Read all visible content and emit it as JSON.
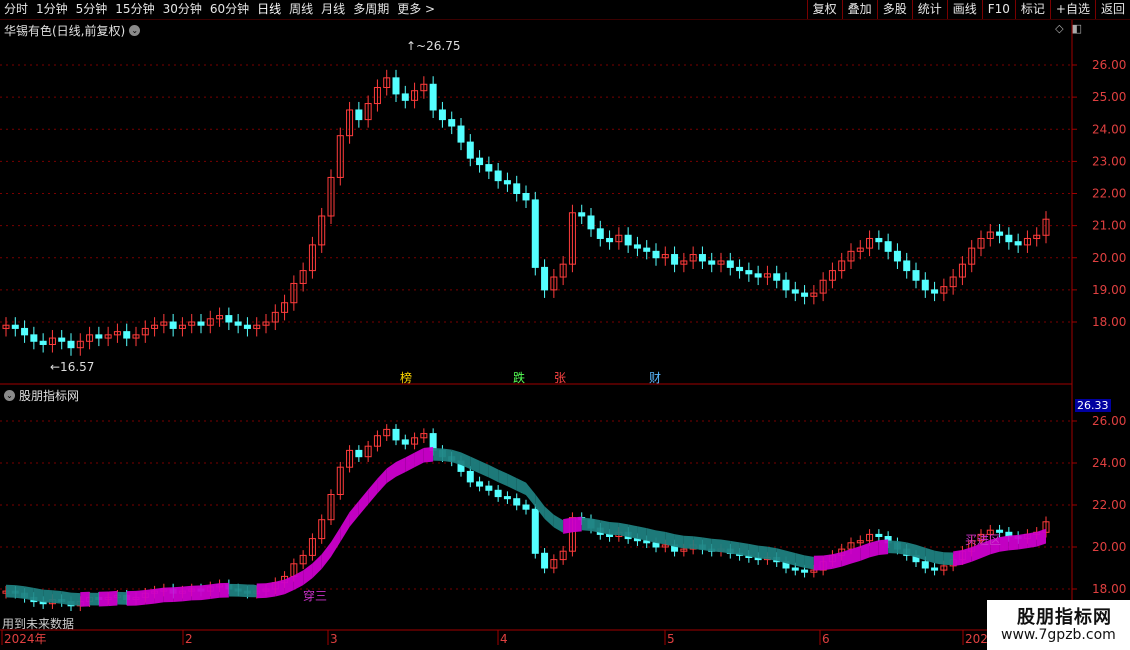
{
  "toolbar": {
    "periods": [
      "分时",
      "1分钟",
      "5分钟",
      "15分钟",
      "30分钟",
      "60分钟",
      "日线",
      "周线",
      "月线",
      "多周期",
      "更多"
    ],
    "active_period": "日线",
    "more_arrow": ">",
    "right_buttons": [
      "复权",
      "叠加",
      "多股",
      "统计",
      "画线",
      "F10",
      "标记",
      "+自选",
      "返回"
    ]
  },
  "main_panel": {
    "title": "华锡有色(日线,前复权)",
    "high_label": "26.75",
    "low_label": "16.57",
    "price_ticks": [
      "26.00",
      "25.00",
      "24.00",
      "23.00",
      "22.00",
      "21.00",
      "20.00",
      "19.00",
      "18.00"
    ],
    "event_markers": [
      {
        "text": "榜",
        "color": "#ffd700"
      },
      {
        "text": "跌",
        "color": "#55ff55"
      },
      {
        "text": "张",
        "color": "#ff4444"
      },
      {
        "text": "财",
        "color": "#5ab8ff"
      }
    ]
  },
  "indicator_panel": {
    "title": "股朋指标网",
    "price_tag": "26.33",
    "price_ticks": [
      "26.00",
      "24.00",
      "22.00",
      "20.00",
      "18.00"
    ],
    "labels": [
      "穿三",
      "买进区"
    ]
  },
  "time_axis": {
    "labels": [
      "2024年",
      "2",
      "3",
      "4",
      "5",
      "6",
      "202"
    ]
  },
  "bottom_note": "用到未来数据",
  "watermark": {
    "title": "股朋指标网",
    "url": "www.7gpzb.com"
  },
  "colors": {
    "up": "#ff3c3c",
    "down": "#54ffff",
    "band_up": "#cc00cc",
    "band_down": "#1f7f7f",
    "axis": "#a00000"
  }
}
